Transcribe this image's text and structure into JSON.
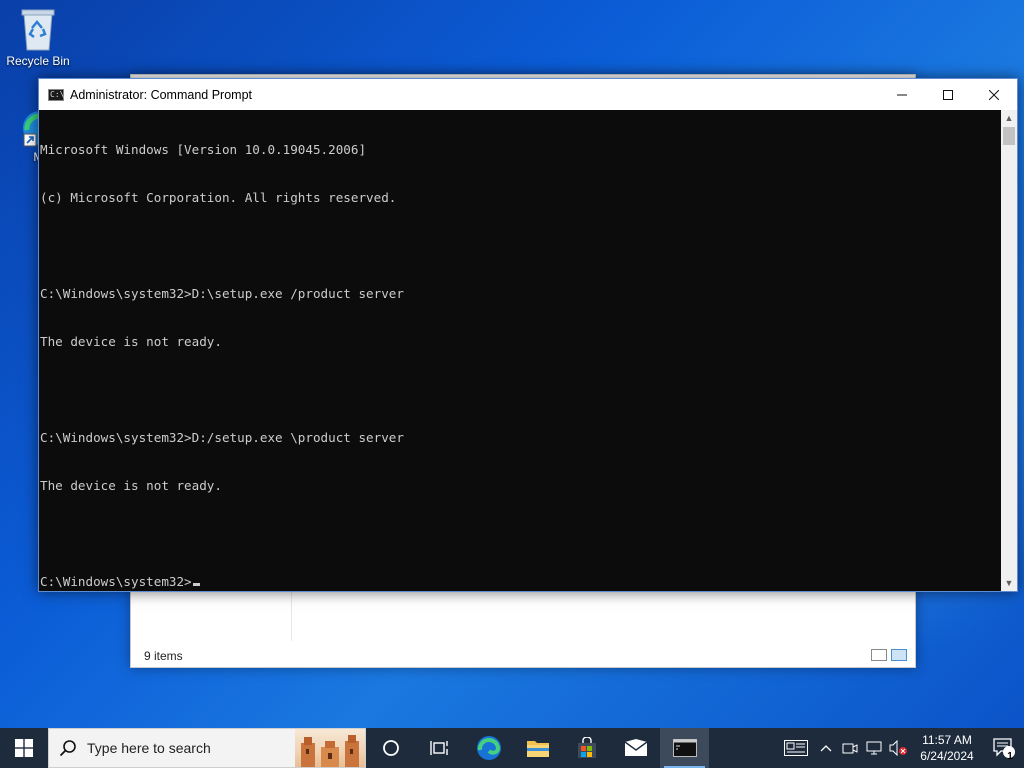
{
  "desktop": {
    "icons": [
      {
        "label": "Recycle Bin"
      },
      {
        "label": "Micr Ed"
      }
    ]
  },
  "explorer": {
    "status_text": "9 items"
  },
  "cmd": {
    "title": "Administrator: Command Prompt",
    "icon_text": "C:\\",
    "lines": [
      "Microsoft Windows [Version 10.0.19045.2006]",
      "(c) Microsoft Corporation. All rights reserved.",
      "",
      "C:\\Windows\\system32>D:\\setup.exe /product server",
      "The device is not ready.",
      "",
      "C:\\Windows\\system32>D:/setup.exe \\product server",
      "The device is not ready.",
      ""
    ],
    "prompt": "C:\\Windows\\system32>"
  },
  "taskbar": {
    "search_placeholder": "Type here to search",
    "clock_time": "11:57 AM",
    "clock_date": "6/24/2024",
    "notification_count": "1"
  }
}
